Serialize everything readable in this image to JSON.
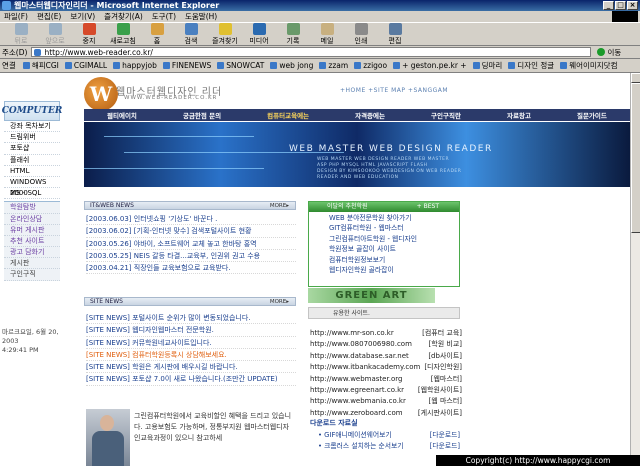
{
  "window": {
    "title": "웹마스터웹디자인리더 - Microsoft Internet Explorer"
  },
  "menu": [
    "파일(F)",
    "편집(E)",
    "보기(V)",
    "즐겨찾기(A)",
    "도구(T)",
    "도움말(H)"
  ],
  "toolbar": [
    "뒤로",
    "앞으로",
    "중지",
    "새로고침",
    "홈",
    "검색",
    "즐겨찾기",
    "미디어",
    "기록",
    "메일",
    "인쇄",
    "편집"
  ],
  "address": {
    "label": "주소(D)",
    "url": "http://www.web-reader.co.kr/",
    "go": "이동"
  },
  "links": {
    "label": "연결",
    "items": [
      "해피CGI",
      "CGIMALL",
      "happyjob",
      "FINENEWS",
      "SNOWCAT",
      "web jong",
      "zzam",
      "zzigoo",
      "+ geston.pe.kr +",
      "딩마리",
      "디자인 정글",
      "웨어이미지닷컴"
    ]
  },
  "site": {
    "logo_letter": "W",
    "title": "웹마스터웹디자인 리더",
    "url": "WWW.WEB-READER.CO.KR",
    "top_links": "+HOME  +SITE MAP  +SANGGAM",
    "nav": [
      "웹티에이치",
      "궁금한점 문의",
      "컴퓨터교육에는",
      "자격증에는",
      "구인구직란",
      "자료창고",
      "질문가이드"
    ],
    "banner": {
      "title": "WEB MASTER WEB DESIGN READER",
      "lines": [
        "WEB MASTER WEB DESIGN READER WEB MASTER",
        "ASP PHP MYSQL HTML JAVASCRIPT FLASH",
        "DESIGN BY KIMSOOKOO WEBDESIGN ON WEB READER",
        "READER AND WEB EDUCATION"
      ]
    },
    "leftnav": {
      "header": "COMPUTER",
      "items": [
        "강좌 목차보기",
        "드림위버",
        "포토샵",
        "플래쉬",
        "HTML",
        "WINDOWS 2000",
        "MS - SQL",
        "학원탐방",
        "온라인상담",
        "유머 게시판",
        "추천 사이트",
        "광고 담화기",
        "게시판",
        "구인구직"
      ]
    },
    "date": [
      "마르크요일, 6월 20, 2003",
      "4:29:41 PM"
    ],
    "it_news": {
      "title": "IT&WEB NEWS",
      "more": "MORE▸",
      "items": [
        "[2003.06.03] 인터넷쇼핑 '기상도' 바꾼다 .",
        "[2003.06.02] [기획-인터넷 맞수] 검색포털사이트 현황",
        "[2003.05.26] 야바이, 소프트웨어 교체 놓고 한바탕 홍역",
        "[2003.05.25] NEIS 갈등 타결...교육부, 인권위 권고 수용",
        "[2003.04.21] 직장인들 교육보험으로 교육받다."
      ]
    },
    "site_news": {
      "title": "SITE NEWS",
      "more": "MORE▸",
      "items": [
        "[SITE NEWS] 포털사이트 순위가 많이 변동되었습니다.",
        "[SITE NEWS] 웹디자인웹마스터 전문학원.",
        "[SITE NEWS] 커뮤학원네교사이트입니다.",
        "[SITE NEWS] 컴퓨터학원등록시 상담해보세요.",
        "[SITE NEWS] 학원은 게시판에 배우시길 바랍니다.",
        "[SITE NEWS] 포토샵 7.0이 새로 나왔습니다.(조만간 UPDATE)"
      ]
    },
    "promo": "그린컴퓨터학원에서 교육비할인 혜택을 드리고 있습니다. 고용보험도 가능하며, 정통부지원 웹마스터웹디자인교육과정이 있으니 참고하세",
    "recommend": {
      "title": "이달의 추천학원",
      "badge": "+ BEST",
      "items": [
        "WEB 분야전문학원 찾아가기",
        "GIT컴퓨터학원 - 웹마스터",
        "그린컴퓨터아트학원 - 웹디자인",
        "학원정보 골잡이 사이트",
        "컴퓨터학원정보보기",
        "웹디자인학원 골라잡이"
      ]
    },
    "green_banner": "GREEN ART",
    "sites": {
      "title": "유용한 사이트.",
      "items": [
        [
          "http://www.mr-son.co.kr",
          "[컴퓨터 교육]"
        ],
        [
          "http://www.0807006980.com",
          "[학원 비교]"
        ],
        [
          "http://www.database.sar.net",
          "[db사이트]"
        ],
        [
          "http://www.itbankacademy.com",
          "[디자인학원]"
        ],
        [
          "http://www.webmaster.org",
          "[웹마스터]"
        ],
        [
          "http://www.egreenart.co.kr",
          "[웹학원사이트]"
        ],
        [
          "http://www.webmania.co.kr",
          "[웹 마스터]"
        ],
        [
          "http://www.zeroboard.com",
          "[게시판사이트]"
        ]
      ]
    },
    "downloads": {
      "title": "다운로드 자료실",
      "items": [
        [
          "• GIF애니메이션웨어보기",
          "[다운로드]"
        ],
        [
          "• 크롬러스 설치하는 순서보기",
          "[다운로드]"
        ]
      ]
    }
  },
  "copyright": "Copyright(c) http://www.happycgi.com"
}
